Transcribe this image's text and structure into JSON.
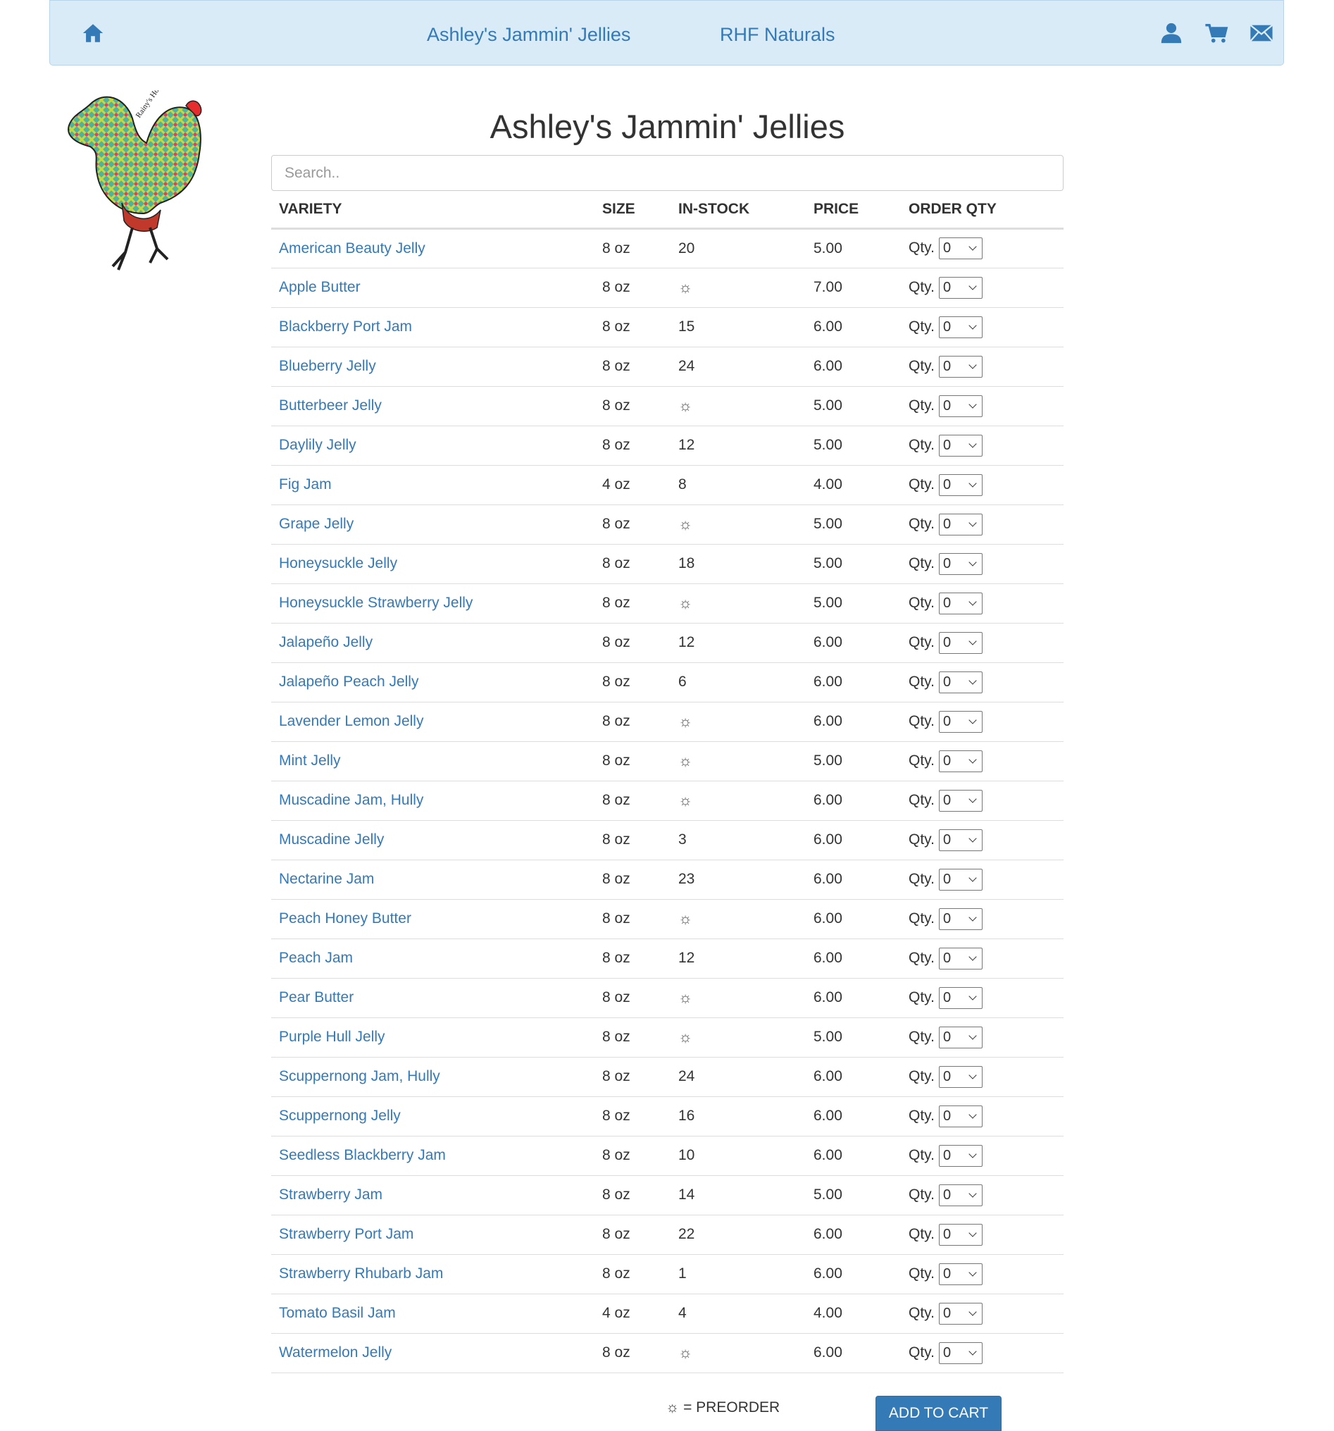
{
  "nav": {
    "home_icon": "home-icon",
    "links": [
      "Ashley's Jammin' Jellies",
      "RHF Naturals"
    ],
    "user_icon": "user-icon",
    "cart_icon": "cart-icon",
    "mail_icon": "envelope-icon"
  },
  "logo": {
    "text": "Rainy's Hobby Farm"
  },
  "page": {
    "title": "Ashley's Jammin' Jellies"
  },
  "search": {
    "placeholder": "Search.."
  },
  "table": {
    "headers": [
      "VARIETY",
      "SIZE",
      "IN-STOCK",
      "PRICE",
      "ORDER QTY"
    ],
    "qty_label": "Qty.",
    "preorder_symbol": "☼",
    "rows": [
      {
        "variety": "American Beauty Jelly",
        "size": "8 oz",
        "stock": "20",
        "price": "5.00",
        "qty": "0"
      },
      {
        "variety": "Apple Butter",
        "size": "8 oz",
        "stock": "☼",
        "price": "7.00",
        "qty": "0"
      },
      {
        "variety": "Blackberry Port Jam",
        "size": "8 oz",
        "stock": "15",
        "price": "6.00",
        "qty": "0"
      },
      {
        "variety": "Blueberry Jelly",
        "size": "8 oz",
        "stock": "24",
        "price": "6.00",
        "qty": "0"
      },
      {
        "variety": "Butterbeer Jelly",
        "size": "8 oz",
        "stock": "☼",
        "price": "5.00",
        "qty": "0"
      },
      {
        "variety": "Daylily Jelly",
        "size": "8 oz",
        "stock": "12",
        "price": "5.00",
        "qty": "0"
      },
      {
        "variety": "Fig Jam",
        "size": "4 oz",
        "stock": "8",
        "price": "4.00",
        "qty": "0"
      },
      {
        "variety": "Grape Jelly",
        "size": "8 oz",
        "stock": "☼",
        "price": "5.00",
        "qty": "0"
      },
      {
        "variety": "Honeysuckle Jelly",
        "size": "8 oz",
        "stock": "18",
        "price": "5.00",
        "qty": "0"
      },
      {
        "variety": "Honeysuckle Strawberry Jelly",
        "size": "8 oz",
        "stock": "☼",
        "price": "5.00",
        "qty": "0"
      },
      {
        "variety": "Jalapeño Jelly",
        "size": "8 oz",
        "stock": "12",
        "price": "6.00",
        "qty": "0"
      },
      {
        "variety": "Jalapeño Peach Jelly",
        "size": "8 oz",
        "stock": "6",
        "price": "6.00",
        "qty": "0"
      },
      {
        "variety": "Lavender Lemon Jelly",
        "size": "8 oz",
        "stock": "☼",
        "price": "6.00",
        "qty": "0"
      },
      {
        "variety": "Mint Jelly",
        "size": "8 oz",
        "stock": "☼",
        "price": "5.00",
        "qty": "0"
      },
      {
        "variety": "Muscadine Jam, Hully",
        "size": "8 oz",
        "stock": "☼",
        "price": "6.00",
        "qty": "0"
      },
      {
        "variety": "Muscadine Jelly",
        "size": "8 oz",
        "stock": "3",
        "price": "6.00",
        "qty": "0"
      },
      {
        "variety": "Nectarine Jam",
        "size": "8 oz",
        "stock": "23",
        "price": "6.00",
        "qty": "0"
      },
      {
        "variety": "Peach Honey Butter",
        "size": "8 oz",
        "stock": "☼",
        "price": "6.00",
        "qty": "0"
      },
      {
        "variety": "Peach Jam",
        "size": "8 oz",
        "stock": "12",
        "price": "6.00",
        "qty": "0"
      },
      {
        "variety": "Pear Butter",
        "size": "8 oz",
        "stock": "☼",
        "price": "6.00",
        "qty": "0"
      },
      {
        "variety": "Purple Hull Jelly",
        "size": "8 oz",
        "stock": "☼",
        "price": "5.00",
        "qty": "0"
      },
      {
        "variety": "Scuppernong Jam, Hully",
        "size": "8 oz",
        "stock": "24",
        "price": "6.00",
        "qty": "0"
      },
      {
        "variety": "Scuppernong Jelly",
        "size": "8 oz",
        "stock": "16",
        "price": "6.00",
        "qty": "0"
      },
      {
        "variety": "Seedless Blackberry Jam",
        "size": "8 oz",
        "stock": "10",
        "price": "6.00",
        "qty": "0"
      },
      {
        "variety": "Strawberry Jam",
        "size": "8 oz",
        "stock": "14",
        "price": "5.00",
        "qty": "0"
      },
      {
        "variety": "Strawberry Port Jam",
        "size": "8 oz",
        "stock": "22",
        "price": "6.00",
        "qty": "0"
      },
      {
        "variety": "Strawberry Rhubarb Jam",
        "size": "8 oz",
        "stock": "1",
        "price": "6.00",
        "qty": "0"
      },
      {
        "variety": "Tomato Basil Jam",
        "size": "4 oz",
        "stock": "4",
        "price": "4.00",
        "qty": "0"
      },
      {
        "variety": "Watermelon Jelly",
        "size": "8 oz",
        "stock": "☼",
        "price": "6.00",
        "qty": "0"
      }
    ]
  },
  "footer": {
    "legend": "☼ = PREORDER",
    "add_to_cart": "ADD TO CART"
  },
  "colors": {
    "accent": "#337ab7",
    "navbar_bg": "#d9ebf7"
  }
}
